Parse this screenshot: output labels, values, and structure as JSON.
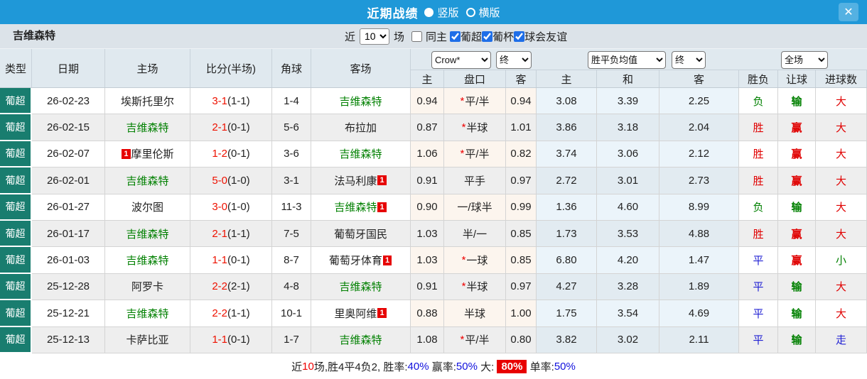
{
  "topbar": {
    "title": "近期战绩",
    "close_icon": "✕",
    "radios": [
      {
        "key": "vertical",
        "label": "竖版",
        "selected": true
      },
      {
        "key": "horizontal",
        "label": "横版",
        "selected": false
      }
    ]
  },
  "filterbar": {
    "team": "吉维森特",
    "near_label": "近",
    "count_value": "10",
    "games_label": "场",
    "checkboxes": [
      {
        "key": "same-home",
        "label": "同主",
        "checked": false
      },
      {
        "key": "pt-league",
        "label": "葡超",
        "checked": true
      },
      {
        "key": "pt-cup",
        "label": "葡杯",
        "checked": true
      },
      {
        "key": "club-friendly",
        "label": "球会友谊",
        "checked": true
      }
    ]
  },
  "table": {
    "selects": {
      "bookmaker": "Crow*",
      "time1": "终",
      "avg": "胜平负均值",
      "time2": "终",
      "scope": "全场"
    },
    "headers": {
      "type": "类型",
      "date": "日期",
      "home": "主场",
      "score": "比分(半场)",
      "corner": "角球",
      "away": "客场",
      "odds_home": "主",
      "handicap": "盘口",
      "odds_away": "客",
      "avg_home": "主",
      "avg_draw": "和",
      "avg_away": "客",
      "result_wdl": "胜负",
      "result_handicap": "让球",
      "result_goals": "进球数"
    },
    "rows": [
      {
        "type": "葡超",
        "date": "26-02-23",
        "home": {
          "name": "埃斯托里尔",
          "self": false,
          "badge": null,
          "badge_pos": null
        },
        "score": "3-1",
        "half": "(1-1)",
        "corner": "1-4",
        "away": {
          "name": "吉维森特",
          "self": true,
          "badge": null,
          "badge_pos": null
        },
        "o1": "0.94",
        "star": true,
        "handicap": "平/半",
        "o2": "0.94",
        "a1": "3.08",
        "a2": "3.39",
        "a3": "2.25",
        "r1": {
          "t": "负",
          "c": "g"
        },
        "r2": {
          "t": "输",
          "c": "g"
        },
        "r3": {
          "t": "大",
          "c": "r"
        }
      },
      {
        "type": "葡超",
        "date": "26-02-15",
        "home": {
          "name": "吉维森特",
          "self": true,
          "badge": null,
          "badge_pos": null
        },
        "score": "2-1",
        "half": "(0-1)",
        "corner": "5-6",
        "away": {
          "name": "布拉加",
          "self": false,
          "badge": null,
          "badge_pos": null
        },
        "o1": "0.87",
        "star": true,
        "handicap": "半球",
        "o2": "1.01",
        "a1": "3.86",
        "a2": "3.18",
        "a3": "2.04",
        "r1": {
          "t": "胜",
          "c": "r"
        },
        "r2": {
          "t": "赢",
          "c": "r"
        },
        "r3": {
          "t": "大",
          "c": "r"
        }
      },
      {
        "type": "葡超",
        "date": "26-02-07",
        "home": {
          "name": "摩里伦斯",
          "self": false,
          "badge": "1",
          "badge_pos": "left"
        },
        "score": "1-2",
        "half": "(0-1)",
        "corner": "3-6",
        "away": {
          "name": "吉维森特",
          "self": true,
          "badge": null,
          "badge_pos": null
        },
        "o1": "1.06",
        "star": true,
        "handicap": "平/半",
        "o2": "0.82",
        "a1": "3.74",
        "a2": "3.06",
        "a3": "2.12",
        "r1": {
          "t": "胜",
          "c": "r"
        },
        "r2": {
          "t": "赢",
          "c": "r"
        },
        "r3": {
          "t": "大",
          "c": "r"
        }
      },
      {
        "type": "葡超",
        "date": "26-02-01",
        "home": {
          "name": "吉维森特",
          "self": true,
          "badge": null,
          "badge_pos": null
        },
        "score": "5-0",
        "half": "(1-0)",
        "corner": "3-1",
        "away": {
          "name": "法马利康",
          "self": false,
          "badge": "1",
          "badge_pos": "right"
        },
        "o1": "0.91",
        "star": false,
        "handicap": "平手",
        "o2": "0.97",
        "a1": "2.72",
        "a2": "3.01",
        "a3": "2.73",
        "r1": {
          "t": "胜",
          "c": "r"
        },
        "r2": {
          "t": "赢",
          "c": "r"
        },
        "r3": {
          "t": "大",
          "c": "r"
        }
      },
      {
        "type": "葡超",
        "date": "26-01-27",
        "home": {
          "name": "波尔图",
          "self": false,
          "badge": null,
          "badge_pos": null
        },
        "score": "3-0",
        "half": "(1-0)",
        "corner": "11-3",
        "away": {
          "name": "吉维森特",
          "self": true,
          "badge": "1",
          "badge_pos": "right"
        },
        "o1": "0.90",
        "star": false,
        "handicap": "一/球半",
        "o2": "0.99",
        "a1": "1.36",
        "a2": "4.60",
        "a3": "8.99",
        "r1": {
          "t": "负",
          "c": "g"
        },
        "r2": {
          "t": "输",
          "c": "g"
        },
        "r3": {
          "t": "大",
          "c": "r"
        }
      },
      {
        "type": "葡超",
        "date": "26-01-17",
        "home": {
          "name": "吉维森特",
          "self": true,
          "badge": null,
          "badge_pos": null
        },
        "score": "2-1",
        "half": "(1-1)",
        "corner": "7-5",
        "away": {
          "name": "葡萄牙国民",
          "self": false,
          "badge": null,
          "badge_pos": null
        },
        "o1": "1.03",
        "star": false,
        "handicap": "半/一",
        "o2": "0.85",
        "a1": "1.73",
        "a2": "3.53",
        "a3": "4.88",
        "r1": {
          "t": "胜",
          "c": "r"
        },
        "r2": {
          "t": "赢",
          "c": "r"
        },
        "r3": {
          "t": "大",
          "c": "r"
        }
      },
      {
        "type": "葡超",
        "date": "26-01-03",
        "home": {
          "name": "吉维森特",
          "self": true,
          "badge": null,
          "badge_pos": null
        },
        "score": "1-1",
        "half": "(0-1)",
        "corner": "8-7",
        "away": {
          "name": "葡萄牙体育",
          "self": false,
          "badge": "1",
          "badge_pos": "right"
        },
        "o1": "1.03",
        "star": true,
        "handicap": "一球",
        "o2": "0.85",
        "a1": "6.80",
        "a2": "4.20",
        "a3": "1.47",
        "r1": {
          "t": "平",
          "c": "b"
        },
        "r2": {
          "t": "赢",
          "c": "r"
        },
        "r3": {
          "t": "小",
          "c": "g"
        }
      },
      {
        "type": "葡超",
        "date": "25-12-28",
        "home": {
          "name": "阿罗卡",
          "self": false,
          "badge": null,
          "badge_pos": null
        },
        "score": "2-2",
        "half": "(2-1)",
        "corner": "4-8",
        "away": {
          "name": "吉维森特",
          "self": true,
          "badge": null,
          "badge_pos": null
        },
        "o1": "0.91",
        "star": true,
        "handicap": "半球",
        "o2": "0.97",
        "a1": "4.27",
        "a2": "3.28",
        "a3": "1.89",
        "r1": {
          "t": "平",
          "c": "b"
        },
        "r2": {
          "t": "输",
          "c": "g"
        },
        "r3": {
          "t": "大",
          "c": "r"
        }
      },
      {
        "type": "葡超",
        "date": "25-12-21",
        "home": {
          "name": "吉维森特",
          "self": true,
          "badge": null,
          "badge_pos": null
        },
        "score": "2-2",
        "half": "(1-1)",
        "corner": "10-1",
        "away": {
          "name": "里奥阿维",
          "self": false,
          "badge": "1",
          "badge_pos": "right"
        },
        "o1": "0.88",
        "star": false,
        "handicap": "半球",
        "o2": "1.00",
        "a1": "1.75",
        "a2": "3.54",
        "a3": "4.69",
        "r1": {
          "t": "平",
          "c": "b"
        },
        "r2": {
          "t": "输",
          "c": "g"
        },
        "r3": {
          "t": "大",
          "c": "r"
        }
      },
      {
        "type": "葡超",
        "date": "25-12-13",
        "home": {
          "name": "卡萨比亚",
          "self": false,
          "badge": null,
          "badge_pos": null
        },
        "score": "1-1",
        "half": "(0-1)",
        "corner": "1-7",
        "away": {
          "name": "吉维森特",
          "self": true,
          "badge": null,
          "badge_pos": null
        },
        "o1": "1.08",
        "star": true,
        "handicap": "平/半",
        "o2": "0.80",
        "a1": "3.82",
        "a2": "3.02",
        "a3": "2.11",
        "r1": {
          "t": "平",
          "c": "b"
        },
        "r2": {
          "t": "输",
          "c": "g"
        },
        "r3": {
          "t": "走",
          "c": "b"
        }
      }
    ]
  },
  "summary": {
    "parts": [
      {
        "t": "近",
        "c": "dark"
      },
      {
        "t": "10",
        "c": "red"
      },
      {
        "t": "场,胜4平4负2, 胜率:",
        "c": "dark"
      },
      {
        "t": "40%",
        "c": "blue"
      },
      {
        "t": " 赢率:",
        "c": "dark"
      },
      {
        "t": "50%",
        "c": "blue"
      },
      {
        "t": " 大: ",
        "c": "dark"
      },
      {
        "t": "80%",
        "c": "badge"
      },
      {
        "t": " 单率:",
        "c": "dark"
      },
      {
        "t": "50%",
        "c": "blue"
      }
    ]
  },
  "colors": {
    "topbar_blue": "#1f98d8",
    "league_teal": "#197d6f",
    "self_team_green": "#008000",
    "win_red": "#e00000",
    "draw_blue": "#2121d3",
    "badge_red": "#e60000"
  }
}
